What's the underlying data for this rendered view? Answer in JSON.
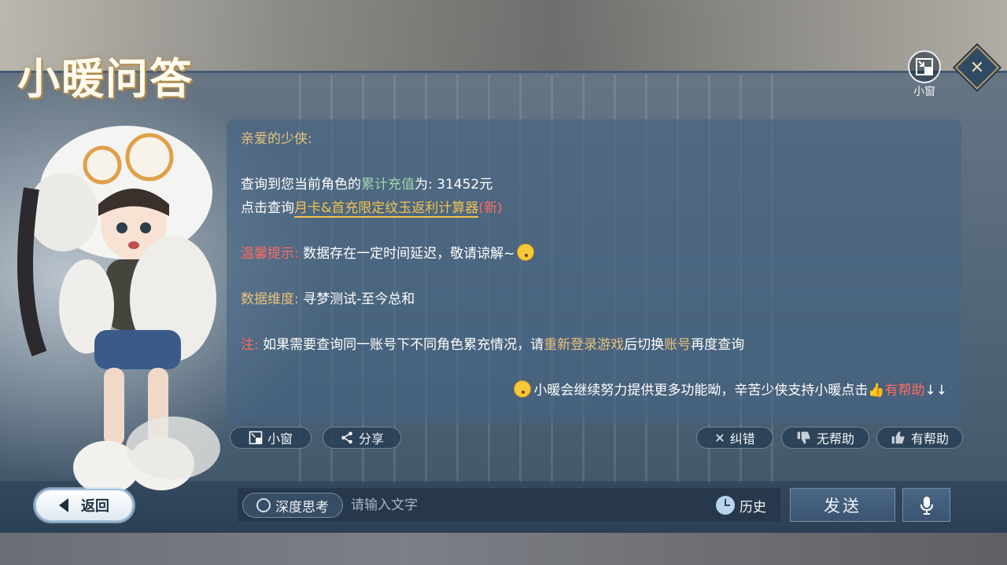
{
  "header": {
    "title": "小暖问答",
    "mini_window_label": "小窗"
  },
  "answer": {
    "greeting": "亲爱的少侠:",
    "line1_prefix": "查询到您当前角色的",
    "line1_highlight": "累计充值",
    "line1_suffix": "为: 31452元",
    "line2_prefix": "点击查询",
    "line2_link": "月卡&首充限定纹玉返利计算器",
    "line2_new": "(新)",
    "tip_label": "温馨提示:",
    "tip_text": "数据存在一定时间延迟，敬请谅解~",
    "dimension_label": "数据维度:",
    "dimension_text": "寻梦测试-至今总和",
    "note_label": "注:",
    "note_text_1": "如果需要查询同一账号下不同角色累充情况，请",
    "note_highlight_1": "重新登录游戏",
    "note_text_2": "后切换",
    "note_highlight_2": "账号",
    "note_text_3": "再度查询",
    "footer_text": "小暖会继续努力提供更多功能呦，辛苦少侠支持小暖点击",
    "footer_helpful": "有帮助",
    "footer_arrows": "↓↓"
  },
  "actions": {
    "mini_window": "小窗",
    "share": "分享",
    "correct": "纠错",
    "unhelpful": "无帮助",
    "helpful": "有帮助"
  },
  "bottom": {
    "back": "返回",
    "deep_think": "深度思考",
    "input_placeholder": "请输入文字",
    "history": "历史",
    "send": "发送"
  },
  "colors": {
    "gold": "#e9c27d",
    "green": "#9fd6a8",
    "red": "#ff6a62",
    "panel": "#46648299"
  }
}
